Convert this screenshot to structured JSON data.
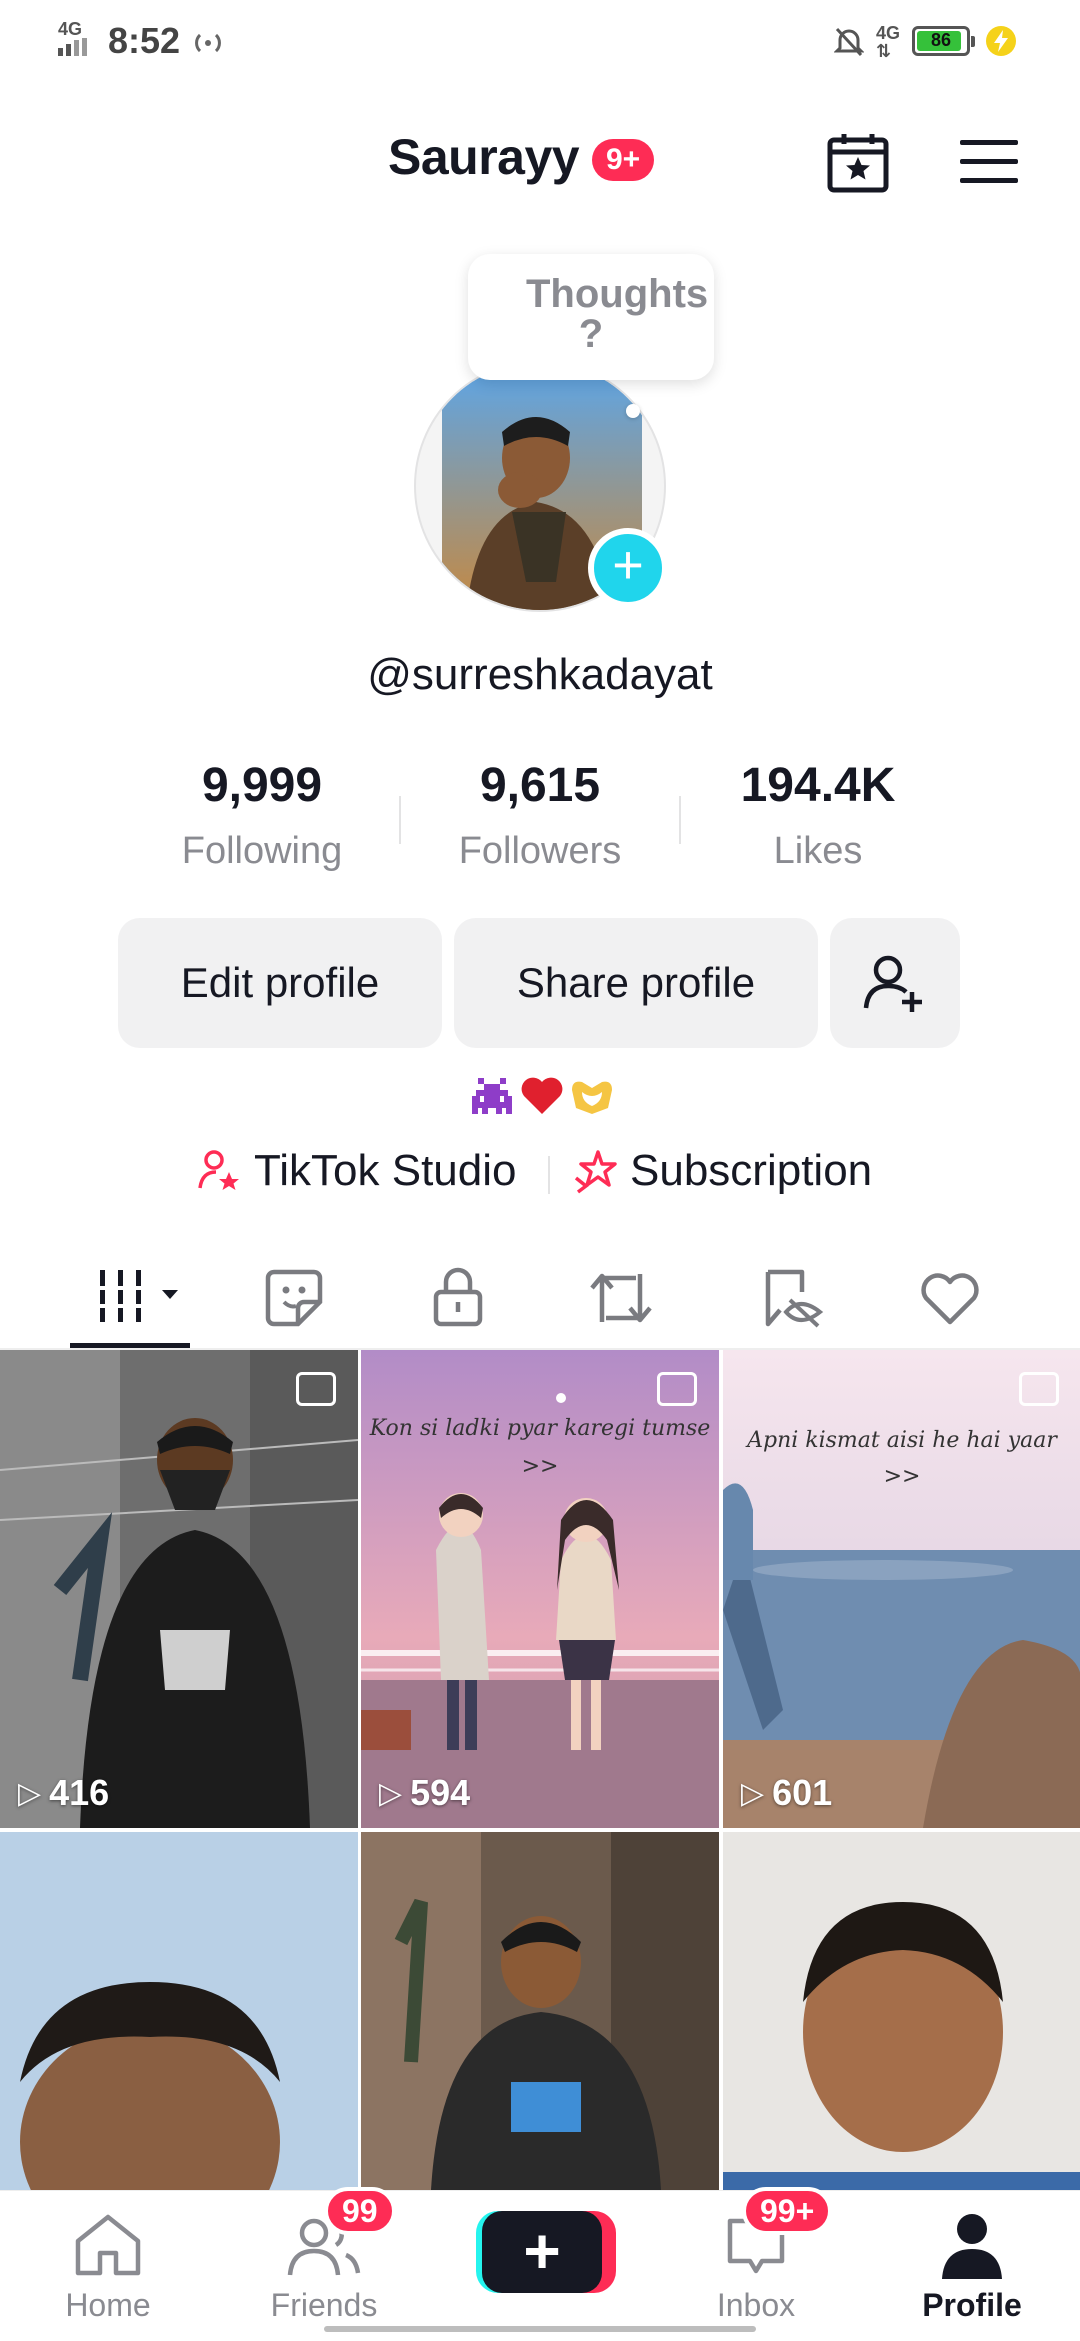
{
  "status_bar": {
    "time": "8:52",
    "network_left": "4G",
    "network_right": "4G",
    "battery": "86"
  },
  "header": {
    "title": "Saurayy",
    "badge": "9+",
    "calendar_icon": "calendar-star-icon",
    "menu_icon": "hamburger-menu-icon"
  },
  "profile": {
    "bubble_text": "Thoughts ?",
    "username": "@surreshkadayat",
    "stats": [
      {
        "value": "9,999",
        "label": "Following"
      },
      {
        "value": "9,615",
        "label": "Followers"
      },
      {
        "value": "194.4K",
        "label": "Likes"
      }
    ],
    "edit_label": "Edit profile",
    "share_label": "Share profile",
    "bio_emojis": [
      "👾",
      "❤️",
      "🫶"
    ],
    "studio_label": "TikTok Studio",
    "subscription_label": "Subscription"
  },
  "tabs": [
    "videos-grid-icon",
    "stickers-icon",
    "lock-icon",
    "repost-icon",
    "hidden-icon",
    "heart-icon"
  ],
  "grid": [
    {
      "views": "416",
      "caption": ""
    },
    {
      "views": "594",
      "caption": "Kon si ladki pyar karegi tumse"
    },
    {
      "views": "601",
      "caption": "Apni kismat aisi he hai yaar"
    },
    {
      "views": "",
      "caption": ""
    },
    {
      "views": "",
      "caption": ""
    },
    {
      "views": "",
      "caption": ""
    }
  ],
  "grid_arrows": ">>",
  "nav": {
    "home": "Home",
    "friends": "Friends",
    "friends_badge": "99",
    "create": "+",
    "inbox": "Inbox",
    "inbox_badge": "99+",
    "profile": "Profile"
  },
  "colors": {
    "accent": "#fe2c55",
    "cyan": "#20d5ec",
    "text": "#161823",
    "muted": "#8a8b91"
  }
}
